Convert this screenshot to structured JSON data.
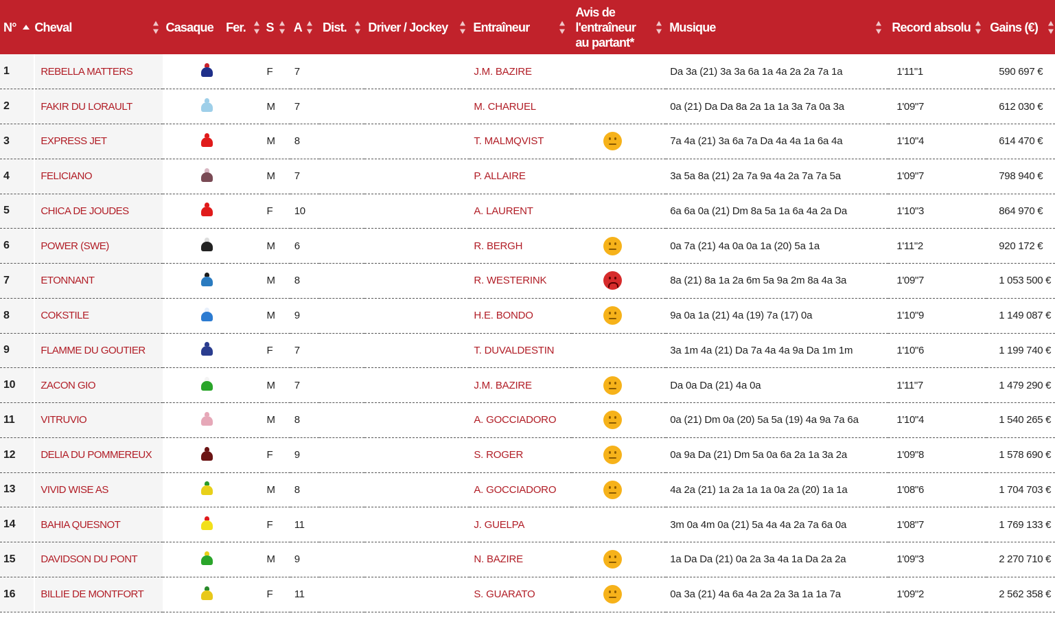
{
  "header": {
    "num": "N°",
    "cheval": "Cheval",
    "casaque": "Casaque",
    "fer": "Fer.",
    "sexe": "S",
    "age": "A",
    "dist": "Dist.",
    "driver": "Driver / Jockey",
    "entraineur": "Entraîneur",
    "avis": "Avis de l'entraîneur au partant*",
    "musique": "Musique",
    "record": "Record absolu",
    "gains": "Gains (€)"
  },
  "rows": [
    {
      "num": "1",
      "horse": "REBELLA MATTERS",
      "silk": [
        "#1f2f8a",
        "#c8202a"
      ],
      "sexe": "F",
      "age": "7",
      "trainer": "J.M. BAZIRE",
      "avis": "",
      "music": "Da 3a (21) 3a 3a 6a 1a 4a 2a 2a 7a 1a",
      "record": "1'11\"1",
      "gains": "590 697 €"
    },
    {
      "num": "2",
      "horse": "FAKIR DU LORAULT",
      "silk": [
        "#9ecfe9",
        "#9ecfe9"
      ],
      "sexe": "M",
      "age": "7",
      "trainer": "M. CHARUEL",
      "avis": "",
      "music": "0a (21) Da Da 8a 2a 1a 1a 3a 7a 0a 3a",
      "record": "1'09\"7",
      "gains": "612 030 €"
    },
    {
      "num": "3",
      "horse": "EXPRESS JET",
      "silk": [
        "#e01b1b",
        "#e01b1b"
      ],
      "sexe": "M",
      "age": "8",
      "trainer": "T. MALMQVIST",
      "avis": "neutral",
      "music": "7a 4a (21) 3a 6a 7a Da 4a 4a 1a 6a 4a",
      "record": "1'10\"4",
      "gains": "614 470 €"
    },
    {
      "num": "4",
      "horse": "FELICIANO",
      "silk": [
        "#7a4a55",
        "#d9b7c3"
      ],
      "sexe": "M",
      "age": "7",
      "trainer": "P. ALLAIRE",
      "avis": "",
      "music": "3a 5a 8a (21) 2a 7a 9a 4a 2a 7a 7a 5a",
      "record": "1'09\"7",
      "gains": "798 940 €"
    },
    {
      "num": "5",
      "horse": "CHICA DE JOUDES",
      "silk": [
        "#e01b1b",
        "#e01b1b"
      ],
      "sexe": "F",
      "age": "10",
      "trainer": "A. LAURENT",
      "avis": "",
      "music": "6a 6a 0a (21) Dm 8a 5a 1a 6a 4a 2a Da",
      "record": "1'10\"3",
      "gains": "864 970 €"
    },
    {
      "num": "6",
      "horse": "POWER (SWE)",
      "silk": [
        "#222222",
        "#dddddd"
      ],
      "sexe": "M",
      "age": "6",
      "trainer": "R. BERGH",
      "avis": "neutral",
      "music": "0a 7a (21) 4a 0a 0a 1a (20) 5a 1a",
      "record": "1'11\"2",
      "gains": "920 172 €"
    },
    {
      "num": "7",
      "horse": "ETONNANT",
      "silk": [
        "#2a7bc0",
        "#1b1b1b"
      ],
      "sexe": "M",
      "age": "8",
      "trainer": "R. WESTERINK",
      "avis": "sad",
      "music": "8a (21) 8a 1a 2a 6m 5a 9a 2m 8a 4a 3a",
      "record": "1'09\"7",
      "gains": "1 053 500 €"
    },
    {
      "num": "8",
      "horse": "COKSTILE",
      "silk": [
        "#2c7bd1",
        "#e8f0fb"
      ],
      "sexe": "M",
      "age": "9",
      "trainer": "H.E. BONDO",
      "avis": "neutral",
      "music": "9a 0a 1a (21) 4a (19) 7a (17) 0a",
      "record": "1'10\"9",
      "gains": "1 149 087 €"
    },
    {
      "num": "9",
      "horse": "FLAMME DU GOUTIER",
      "silk": [
        "#2a3d8f",
        "#2a3d8f"
      ],
      "sexe": "F",
      "age": "7",
      "trainer": "T. DUVALDESTIN",
      "avis": "",
      "music": "3a 1m 4a (21) Da 7a 4a 4a 9a Da 1m 1m",
      "record": "1'10\"6",
      "gains": "1 199 740 €"
    },
    {
      "num": "10",
      "horse": "ZACON GIO",
      "silk": [
        "#2aa52a",
        "#f4f4f4"
      ],
      "sexe": "M",
      "age": "7",
      "trainer": "J.M. BAZIRE",
      "avis": "neutral",
      "music": "Da 0a Da (21) 4a 0a",
      "record": "1'11\"7",
      "gains": "1 479 290 €"
    },
    {
      "num": "11",
      "horse": "VITRUVIO",
      "silk": [
        "#e6a8b8",
        "#e6a8b8"
      ],
      "sexe": "M",
      "age": "8",
      "trainer": "A. GOCCIADORO",
      "avis": "neutral",
      "music": "0a (21) Dm 0a (20) 5a 5a (19) 4a 9a 7a 6a",
      "record": "1'10\"4",
      "gains": "1 540 265 €"
    },
    {
      "num": "12",
      "horse": "DELIA DU POMMEREUX",
      "silk": [
        "#6b1414",
        "#6b1414"
      ],
      "sexe": "F",
      "age": "9",
      "trainer": "S. ROGER",
      "avis": "neutral",
      "music": "0a 9a Da (21) Dm 5a 0a 6a 2a 1a 3a 2a",
      "record": "1'09\"8",
      "gains": "1 578 690 €"
    },
    {
      "num": "13",
      "horse": "VIVID WISE AS",
      "silk": [
        "#e8d01a",
        "#2a9a2a"
      ],
      "sexe": "M",
      "age": "8",
      "trainer": "A. GOCCIADORO",
      "avis": "neutral",
      "music": "4a 2a (21) 1a 2a 1a 1a 0a 2a (20) 1a 1a",
      "record": "1'08\"6",
      "gains": "1 704 703 €"
    },
    {
      "num": "14",
      "horse": "BAHIA QUESNOT",
      "silk": [
        "#f2e01a",
        "#e01b1b"
      ],
      "sexe": "F",
      "age": "11",
      "trainer": "J. GUELPA",
      "avis": "",
      "music": "3m 0a 4m 0a (21) 5a 4a 4a 2a 7a 6a 0a",
      "record": "1'08\"7",
      "gains": "1 769 133 €"
    },
    {
      "num": "15",
      "horse": "DAVIDSON DU PONT",
      "silk": [
        "#2aa52a",
        "#e8d01a"
      ],
      "sexe": "M",
      "age": "9",
      "trainer": "N. BAZIRE",
      "avis": "neutral",
      "music": "1a Da Da (21) 0a 2a 3a 4a 1a Da 2a 2a",
      "record": "1'09\"3",
      "gains": "2 270 710 €"
    },
    {
      "num": "16",
      "horse": "BILLIE DE MONTFORT",
      "silk": [
        "#e8c81a",
        "#2a8a2a"
      ],
      "sexe": "F",
      "age": "11",
      "trainer": "S. GUARATO",
      "avis": "neutral",
      "music": "0a 3a (21) 4a 6a 4a 2a 2a 3a 1a 1a 7a",
      "record": "1'09\"2",
      "gains": "2 562 358 €"
    }
  ]
}
